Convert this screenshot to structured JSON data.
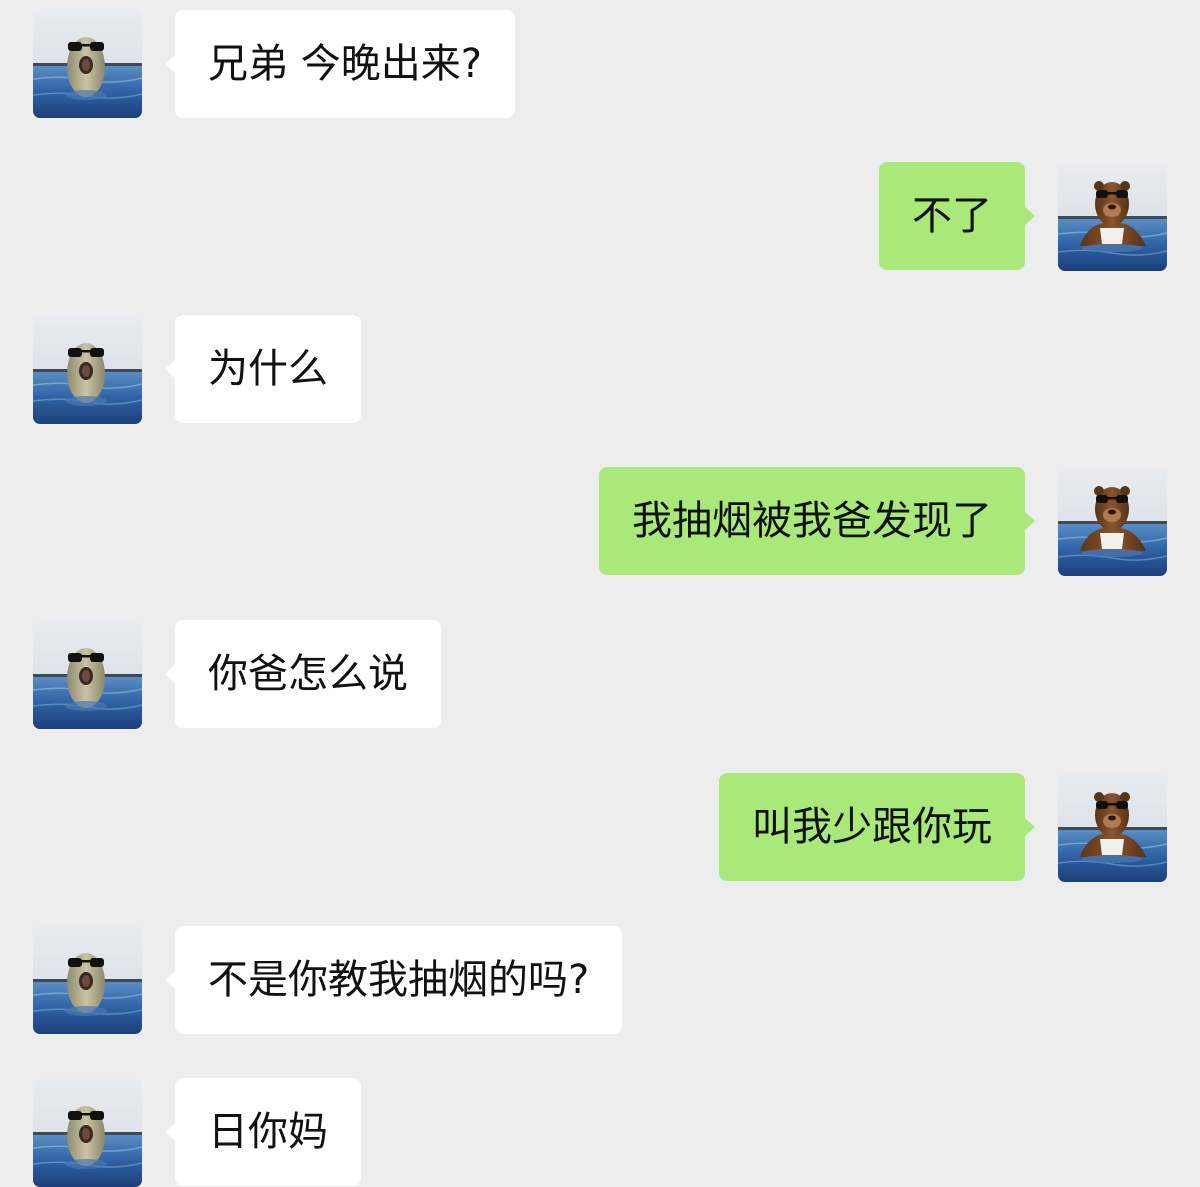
{
  "messages": [
    {
      "side": "in",
      "text": "兄弟 今晚出来?"
    },
    {
      "side": "out",
      "text": "不了"
    },
    {
      "side": "in",
      "text": "为什么"
    },
    {
      "side": "out",
      "text": "我抽烟被我爸发现了"
    },
    {
      "side": "in",
      "text": "你爸怎么说"
    },
    {
      "side": "out",
      "text": "叫我少跟你玩"
    },
    {
      "side": "in",
      "text": "不是你教我抽烟的吗?"
    },
    {
      "side": "in",
      "text": "日你妈"
    }
  ],
  "colors": {
    "background": "#ededed",
    "incoming_bubble": "#ffffff",
    "outgoing_bubble": "#a9e97a",
    "text": "#111111"
  },
  "icons": {
    "contact_avatar": "seal-with-sunglasses-avatar",
    "self_avatar": "brown-bear-with-sunglasses-avatar"
  }
}
